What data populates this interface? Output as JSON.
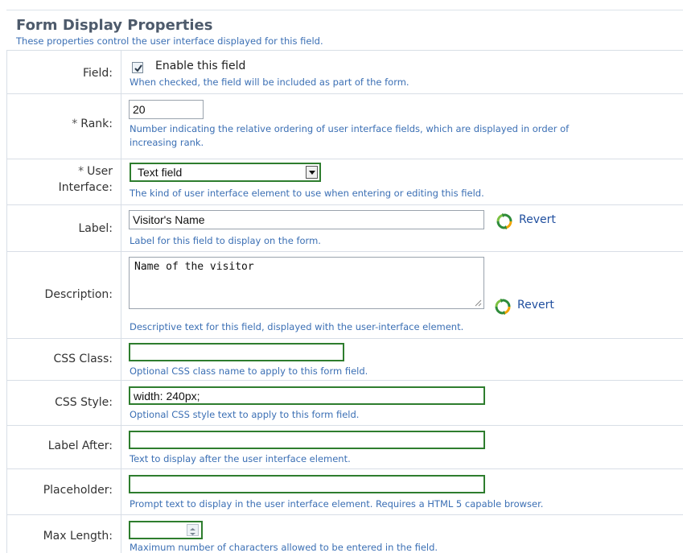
{
  "section": {
    "title": "Form Display Properties",
    "subtitle": "These properties control the user interface displayed for this field."
  },
  "rows": {
    "field": {
      "label": "Field:",
      "checkbox_label": "Enable this field",
      "checked": true,
      "help": "When checked, the field will be included as part of the form."
    },
    "rank": {
      "required_mark": "*",
      "label": "Rank:",
      "value": "20",
      "help_line1": "Number indicating the relative ordering of user interface fields, which are displayed in order of",
      "help_line2": "increasing rank."
    },
    "user_interface": {
      "required_mark": "*",
      "label_line1": "User",
      "label_line2": "Interface:",
      "selected": "Text field",
      "help": "The kind of user interface element to use when entering or editing this field."
    },
    "label": {
      "label": "Label:",
      "value": "Visitor's Name",
      "revert": "Revert",
      "help": "Label for this field to display on the form."
    },
    "description": {
      "label": "Description:",
      "value": "Name of the visitor",
      "revert": "Revert",
      "help": "Descriptive text for this field, displayed with the user-interface element."
    },
    "css_class": {
      "label": "CSS Class:",
      "value": "",
      "help": "Optional CSS class name to apply to this form field."
    },
    "css_style": {
      "label": "CSS Style:",
      "value": "width: 240px;",
      "help": "Optional CSS style text to apply to this form field."
    },
    "label_after": {
      "label": "Label After:",
      "value": "",
      "help": "Text to display after the user interface element."
    },
    "placeholder": {
      "label": "Placeholder:",
      "value": "",
      "help": "Prompt text to display in the user interface element. Requires a HTML 5 capable browser."
    },
    "max_length": {
      "label": "Max Length:",
      "value": "",
      "help": "Maximum number of characters allowed to be entered in the field."
    }
  },
  "colors": {
    "heading": "#4d5a6b",
    "help_text": "#3b6fb4",
    "link": "#1f4e9e",
    "focus_border": "#2e7d2e",
    "grid_line": "#d8dee6"
  }
}
